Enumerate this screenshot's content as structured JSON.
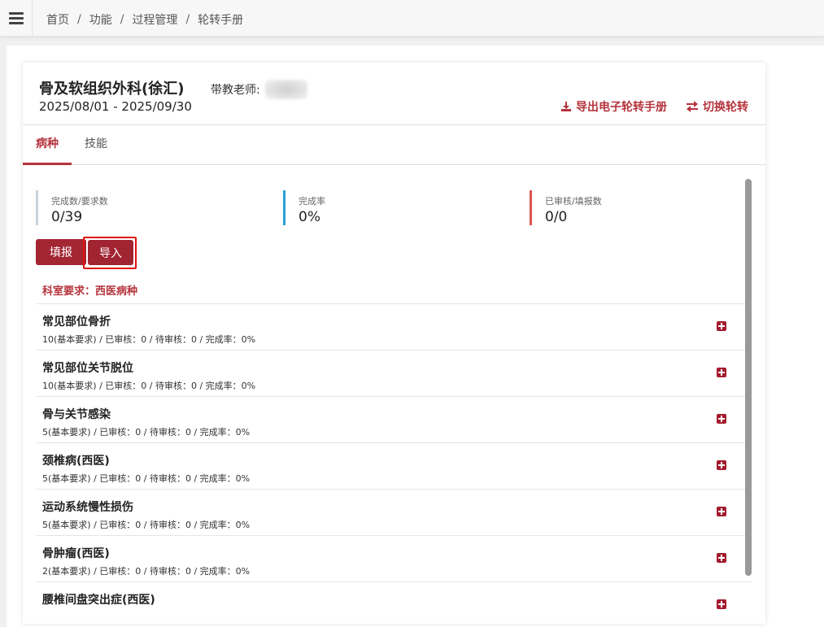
{
  "breadcrumb": [
    "首页",
    "功能",
    "过程管理",
    "轮转手册"
  ],
  "header": {
    "dept_title": "骨及软组织外科(徐汇)",
    "teacher_label": "带教老师:",
    "date_range": "2025/08/01 - 2025/09/30",
    "export_label": "导出电子轮转手册",
    "switch_label": "切换轮转"
  },
  "tabs": [
    {
      "label": "病种",
      "active": true
    },
    {
      "label": "技能",
      "active": false
    }
  ],
  "stats": [
    {
      "label": "完成数/要求数",
      "value": "0/39",
      "color": "#c8d3dc"
    },
    {
      "label": "完成率",
      "value": "0%",
      "color": "#2a9fd6"
    },
    {
      "label": "已审核/填报数",
      "value": "0/0",
      "color": "#e05252"
    }
  ],
  "actions": {
    "fill_label": "填报",
    "import_label": "导入"
  },
  "dept_requirement": "科室要求：西医病种",
  "items": [
    {
      "name": "常见部位骨折",
      "meta": "10(基本要求) / 已审核：0 / 待审核：0 / 完成率：0%"
    },
    {
      "name": "常见部位关节脱位",
      "meta": "10(基本要求) / 已审核：0 / 待审核：0 / 完成率：0%"
    },
    {
      "name": "骨与关节感染",
      "meta": "5(基本要求) / 已审核：0 / 待审核：0 / 完成率：0%"
    },
    {
      "name": "颈椎病(西医)",
      "meta": "5(基本要求) / 已审核：0 / 待审核：0 / 完成率：0%"
    },
    {
      "name": "运动系统慢性损伤",
      "meta": "5(基本要求) / 已审核：0 / 待审核：0 / 完成率：0%"
    },
    {
      "name": "骨肿瘤(西医)",
      "meta": "2(基本要求) / 已审核：0 / 待审核：0 / 完成率：0%"
    },
    {
      "name": "腰椎间盘突出症(西医)",
      "meta": ""
    }
  ],
  "colors": {
    "accent": "#b5343d",
    "button": "#a32633",
    "highlight": "#e01010"
  }
}
